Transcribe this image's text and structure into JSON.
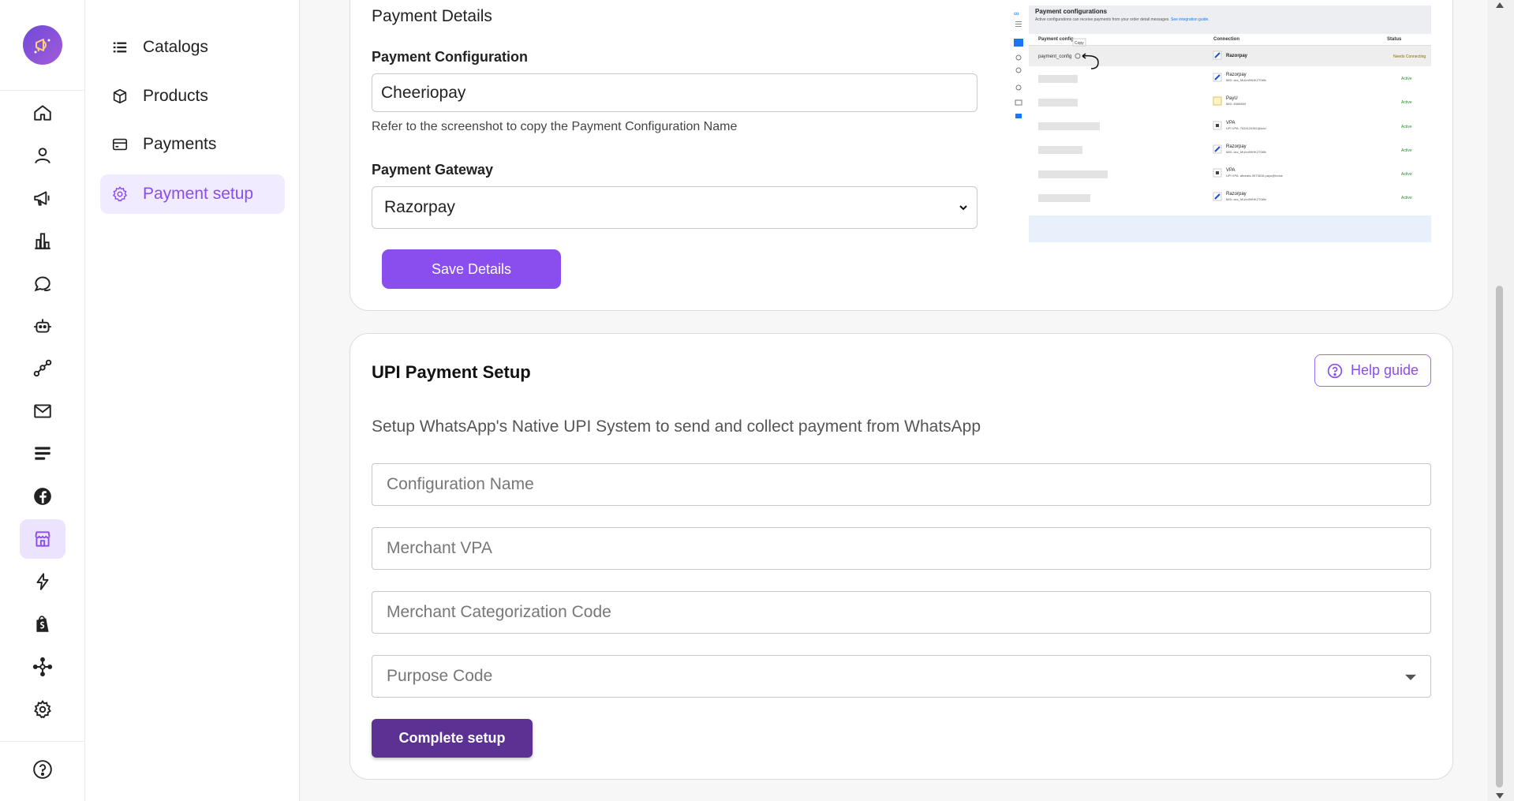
{
  "rail": {
    "items": [
      {
        "name": "home-icon"
      },
      {
        "name": "user-icon"
      },
      {
        "name": "megaphone-icon"
      },
      {
        "name": "bar-chart-icon"
      },
      {
        "name": "chat-icon"
      },
      {
        "name": "bot-icon"
      },
      {
        "name": "flow-icon"
      },
      {
        "name": "mail-icon"
      },
      {
        "name": "list-icon"
      },
      {
        "name": "facebook-icon"
      },
      {
        "name": "store-icon",
        "active": true
      },
      {
        "name": "lightning-icon"
      },
      {
        "name": "shopify-icon"
      },
      {
        "name": "integration-icon"
      },
      {
        "name": "settings-icon"
      }
    ],
    "help_icon": "help-circle-icon"
  },
  "subnav": {
    "items": [
      {
        "label": "Catalogs",
        "icon": "list-icon"
      },
      {
        "label": "Products",
        "icon": "box-icon"
      },
      {
        "label": "Payments",
        "icon": "card-icon"
      },
      {
        "label": "Payment setup",
        "icon": "gear-icon",
        "active": true
      }
    ]
  },
  "payment_details": {
    "title": "Payment Details",
    "config_label": "Payment Configuration",
    "config_value": "Cheeriopay",
    "config_helper": "Refer to the screenshot to copy the Payment Configuration Name",
    "gateway_label": "Payment Gateway",
    "gateway_value": "Razorpay",
    "save_label": "Save Details"
  },
  "preview": {
    "title": "Payment configurations",
    "subtitle": "Active configurations can receive payments from your order detail messages.",
    "link": "See integration guide.",
    "col_name": "Payment config",
    "col_connection": "Connection",
    "col_status": "Status",
    "copy_tooltip": "Copy",
    "first_row_name": "payment_config",
    "rows": [
      {
        "connection": "Razorpay",
        "sub": "",
        "status": "Needs Connecting"
      },
      {
        "connection": "Razorpay",
        "sub": "MID: acc_MUhn59HK2T0i8h",
        "status": "Active"
      },
      {
        "connection": "PayU",
        "sub": "MID: 8368659",
        "status": "Active"
      },
      {
        "connection": "VPA",
        "sub": "UPI VPA: 7024124361@icici",
        "status": "Active"
      },
      {
        "connection": "Razorpay",
        "sub": "MID: acc_MUhn59HK2T0i8h",
        "status": "Active"
      },
      {
        "connection": "VPA",
        "sub": "UPI VPA: ativeats-9573816.payu@indus",
        "status": "Active"
      },
      {
        "connection": "Razorpay",
        "sub": "MID: acc_MUhn59HK2T0i8h",
        "status": "Active"
      }
    ]
  },
  "upi": {
    "title": "UPI Payment Setup",
    "help_label": "Help guide",
    "description": "Setup WhatsApp's Native UPI System to send and collect payment from WhatsApp",
    "config_name_placeholder": "Configuration Name",
    "merchant_vpa_placeholder": "Merchant VPA",
    "mcc_placeholder": "Merchant Categorization Code",
    "purpose_code_placeholder": "Purpose Code",
    "complete_label": "Complete setup"
  },
  "colors": {
    "accent": "#8a4dee",
    "accent_dark": "#5b3294",
    "active_bg": "#ece3ff"
  }
}
